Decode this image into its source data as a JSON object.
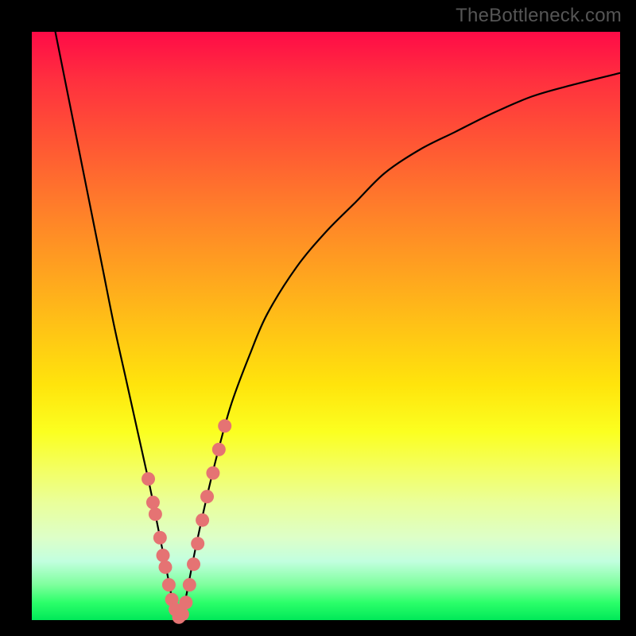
{
  "watermark": "TheBottleneck.com",
  "colors": {
    "frame": "#000000",
    "curve_stroke": "#000000",
    "marker_fill": "#e57373",
    "marker_stroke": "#e57373",
    "gradient_top": "#ff0b47",
    "gradient_bottom": "#00e858"
  },
  "chart_data": {
    "type": "line",
    "title": "",
    "xlabel": "",
    "ylabel": "",
    "xlim": [
      0,
      100
    ],
    "ylim": [
      0,
      100
    ],
    "grid": false,
    "legend": false,
    "note": "Two curved branches (black) descend from the top edge toward a common valley near x≈23–27 at y≈0, then the right branch rises toward the top-right. The strip near y=0 is green (good / no bottleneck) and the top is red (high bottleneck). Salmon markers cluster on both branches near the valley.",
    "series": [
      {
        "name": "left_branch",
        "x": [
          4,
          6,
          8,
          10,
          12,
          14,
          16,
          18,
          20,
          21,
          22,
          23,
          24,
          25
        ],
        "y": [
          100,
          90,
          80,
          70,
          60,
          50,
          41,
          32,
          23,
          18,
          13,
          8,
          3,
          0
        ]
      },
      {
        "name": "right_branch",
        "x": [
          25,
          26,
          27,
          28,
          30,
          32,
          34,
          37,
          40,
          45,
          50,
          55,
          60,
          66,
          72,
          78,
          85,
          92,
          100
        ],
        "y": [
          0,
          3,
          8,
          13,
          22,
          30,
          37,
          45,
          52,
          60,
          66,
          71,
          76,
          80,
          83,
          86,
          89,
          91,
          93
        ]
      }
    ],
    "markers": {
      "name": "highlighted_points",
      "x": [
        19.8,
        20.6,
        21.0,
        21.8,
        22.3,
        22.7,
        23.3,
        23.8,
        24.4,
        25.0,
        25.6,
        26.2,
        26.8,
        27.5,
        28.2,
        29.0,
        29.8,
        30.8,
        31.8,
        32.8
      ],
      "y": [
        24,
        20,
        18,
        14,
        11,
        9,
        6,
        3.5,
        1.8,
        0.5,
        1.0,
        3.0,
        6.0,
        9.5,
        13.0,
        17.0,
        21.0,
        25.0,
        29.0,
        33.0
      ]
    }
  }
}
